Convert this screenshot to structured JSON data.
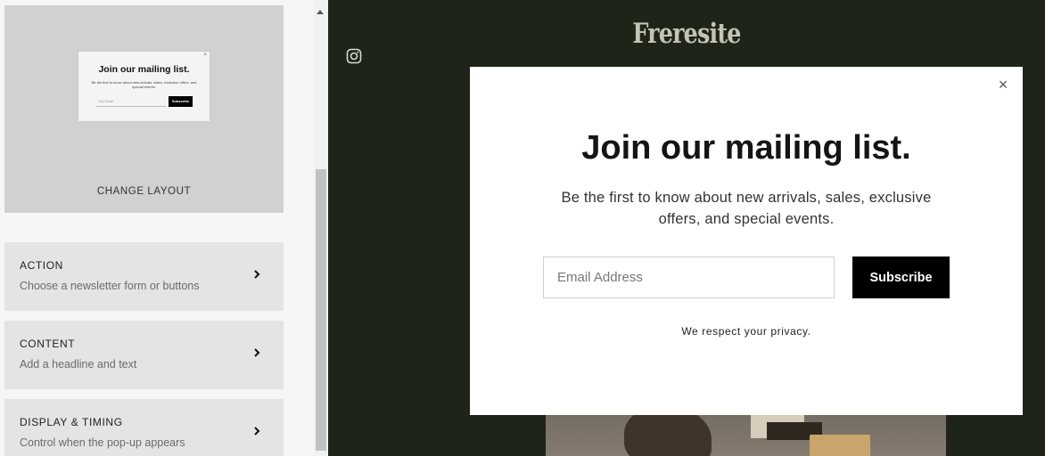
{
  "editor": {
    "layout_preview": {
      "title": "Join our mailing list.",
      "text": "Be the first to know about new arrivals, sales, exclusive offers, and special events.",
      "input_placeholder": "Your Email",
      "button_label": "Subscribe",
      "close_glyph": "×"
    },
    "change_layout_label": "CHANGE LAYOUT",
    "options": [
      {
        "title": "ACTION",
        "subtitle": "Choose a newsletter form or buttons",
        "icon": "chevron-right-icon"
      },
      {
        "title": "CONTENT",
        "subtitle": "Add a headline and text",
        "icon": "chevron-right-icon"
      },
      {
        "title": "DISPLAY & TIMING",
        "subtitle": "Control when the pop-up appears",
        "icon": "chevron-right-icon"
      }
    ]
  },
  "site": {
    "logo": "Freresite",
    "social_icon": "instagram-icon",
    "background_color": "#1e2418"
  },
  "popup": {
    "close_glyph": "×",
    "title": "Join our mailing list.",
    "text": "Be the first to know about new arrivals, sales, exclusive offers, and special events.",
    "email_placeholder": "Email Address",
    "subscribe_label": "Subscribe",
    "privacy": "We respect your privacy."
  }
}
